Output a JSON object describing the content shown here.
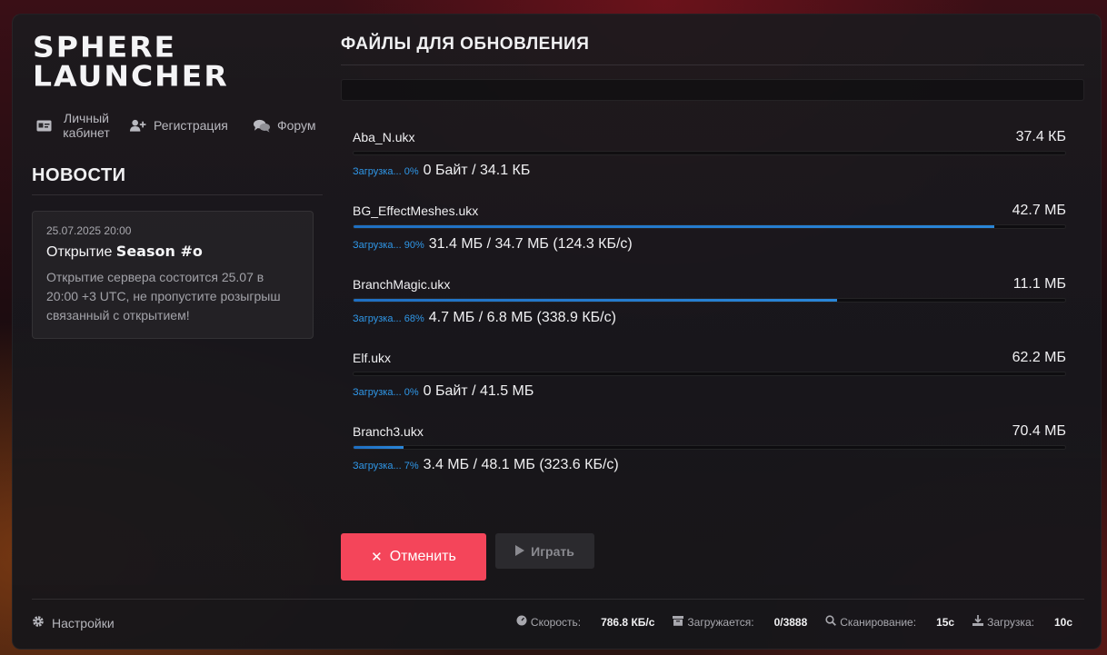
{
  "logo": {
    "line1": "SPHERE",
    "line2": "LAUNCHER"
  },
  "nav": [
    {
      "label": "Личный кабинет",
      "icon": "id-card-icon"
    },
    {
      "label": "Регистрация",
      "icon": "user-plus-icon"
    },
    {
      "label": "Форум",
      "icon": "comments-icon"
    }
  ],
  "news": {
    "title": "НОВОСТИ",
    "items": [
      {
        "date": "25.07.2025 20:00",
        "headline_prefix": "Открытие",
        "headline_bold": "Season #o",
        "body": "Открытие сервера состоится 25.07 в 20:00 +3 UTC, не пропустите розыгрыш связанный с открытием!"
      }
    ]
  },
  "main": {
    "title": "ФАЙЛЫ ДЛЯ ОБНОВЛЕНИЯ",
    "files": [
      {
        "name": "Aba_N.ukx",
        "size": "37.4 КБ",
        "status_label": "Загрузка... 0%",
        "progress": 0,
        "detail": "0 Байт / 34.1 КБ"
      },
      {
        "name": "BG_EffectMeshes.ukx",
        "size": "42.7 МБ",
        "status_label": "Загрузка... 90%",
        "progress": 0.9,
        "detail": "31.4 МБ / 34.7 МБ (124.3 КБ/с)"
      },
      {
        "name": "BranchMagic.ukx",
        "size": "11.1 МБ",
        "status_label": "Загрузка... 68%",
        "progress": 0.68,
        "detail": "4.7 МБ / 6.8 МБ (338.9 КБ/с)"
      },
      {
        "name": "Elf.ukx",
        "size": "62.2 МБ",
        "status_label": "Загрузка... 0%",
        "progress": 0,
        "detail": "0 Байт / 41.5 МБ"
      },
      {
        "name": "Branch3.ukx",
        "size": "70.4 МБ",
        "status_label": "Загрузка... 7%",
        "progress": 0.07,
        "detail": "3.4 МБ / 48.1 МБ (323.6 КБ/с)"
      }
    ],
    "cancel_label": "Отменить",
    "play_label": "Играть"
  },
  "footer": {
    "settings_label": "Настройки",
    "stats": [
      {
        "label": "Скорость:",
        "value": "786.8 КБ/с",
        "icon": "speedometer-icon"
      },
      {
        "label": "Загружается:",
        "value": "0/3888",
        "icon": "archive-icon"
      },
      {
        "label": "Сканирование:",
        "value": "15с",
        "icon": "search-icon"
      },
      {
        "label": "Загрузка:",
        "value": "10с",
        "icon": "download-icon"
      }
    ]
  },
  "colors": {
    "accent": "#2a86d8",
    "cancel": "#f4455a",
    "status_text": "#2f97e8"
  }
}
